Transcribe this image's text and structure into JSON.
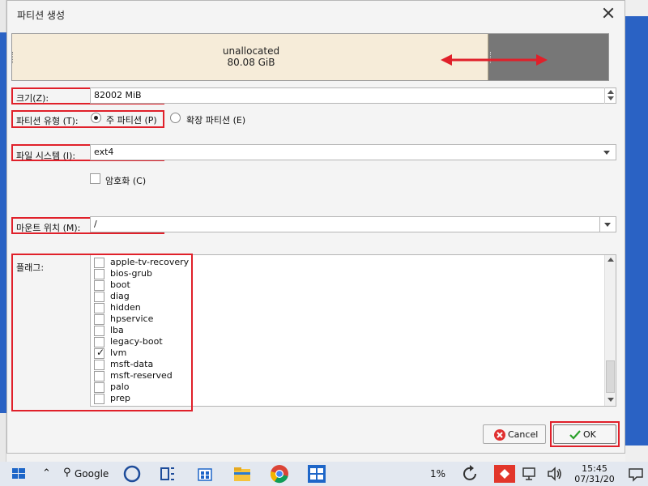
{
  "dialog": {
    "title": "파티션 생성",
    "close_icon": "close-icon"
  },
  "partition_bar": {
    "label_line1": "unallocated",
    "label_line2": "80.08 GiB"
  },
  "size": {
    "label": "크기(Z):",
    "value": "82002 MiB"
  },
  "partition_type": {
    "label": "파티션 유형 (T):",
    "options": [
      {
        "label": "주 파티션 (P)",
        "selected": true
      },
      {
        "label": "확장 파티션 (E)",
        "selected": false
      }
    ]
  },
  "filesystem": {
    "label": "파일 시스템 (I):",
    "value": "ext4"
  },
  "encryption": {
    "label": "암호화 (C)",
    "checked": false
  },
  "mount_point": {
    "label": "마운트 위치 (M):",
    "value": "/"
  },
  "flags": {
    "label": "플래그:",
    "items": [
      {
        "name": "apple-tv-recovery",
        "checked": false
      },
      {
        "name": "bios-grub",
        "checked": false
      },
      {
        "name": "boot",
        "checked": false
      },
      {
        "name": "diag",
        "checked": false
      },
      {
        "name": "hidden",
        "checked": false
      },
      {
        "name": "hpservice",
        "checked": false
      },
      {
        "name": "lba",
        "checked": false
      },
      {
        "name": "legacy-boot",
        "checked": false
      },
      {
        "name": "lvm",
        "checked": true
      },
      {
        "name": "msft-data",
        "checked": false
      },
      {
        "name": "msft-reserved",
        "checked": false
      },
      {
        "name": "palo",
        "checked": false
      },
      {
        "name": "prep",
        "checked": false
      }
    ]
  },
  "buttons": {
    "cancel": "Cancel",
    "ok": "OK"
  },
  "taskbar": {
    "search_label": "Google",
    "battery": "1%",
    "time": "15:45",
    "date": "07/31/20"
  },
  "colors": {
    "highlight": "#e0202a",
    "desktop": "#1e56b8",
    "unallocated": "#f6ecd9",
    "free_space": "#777777"
  }
}
